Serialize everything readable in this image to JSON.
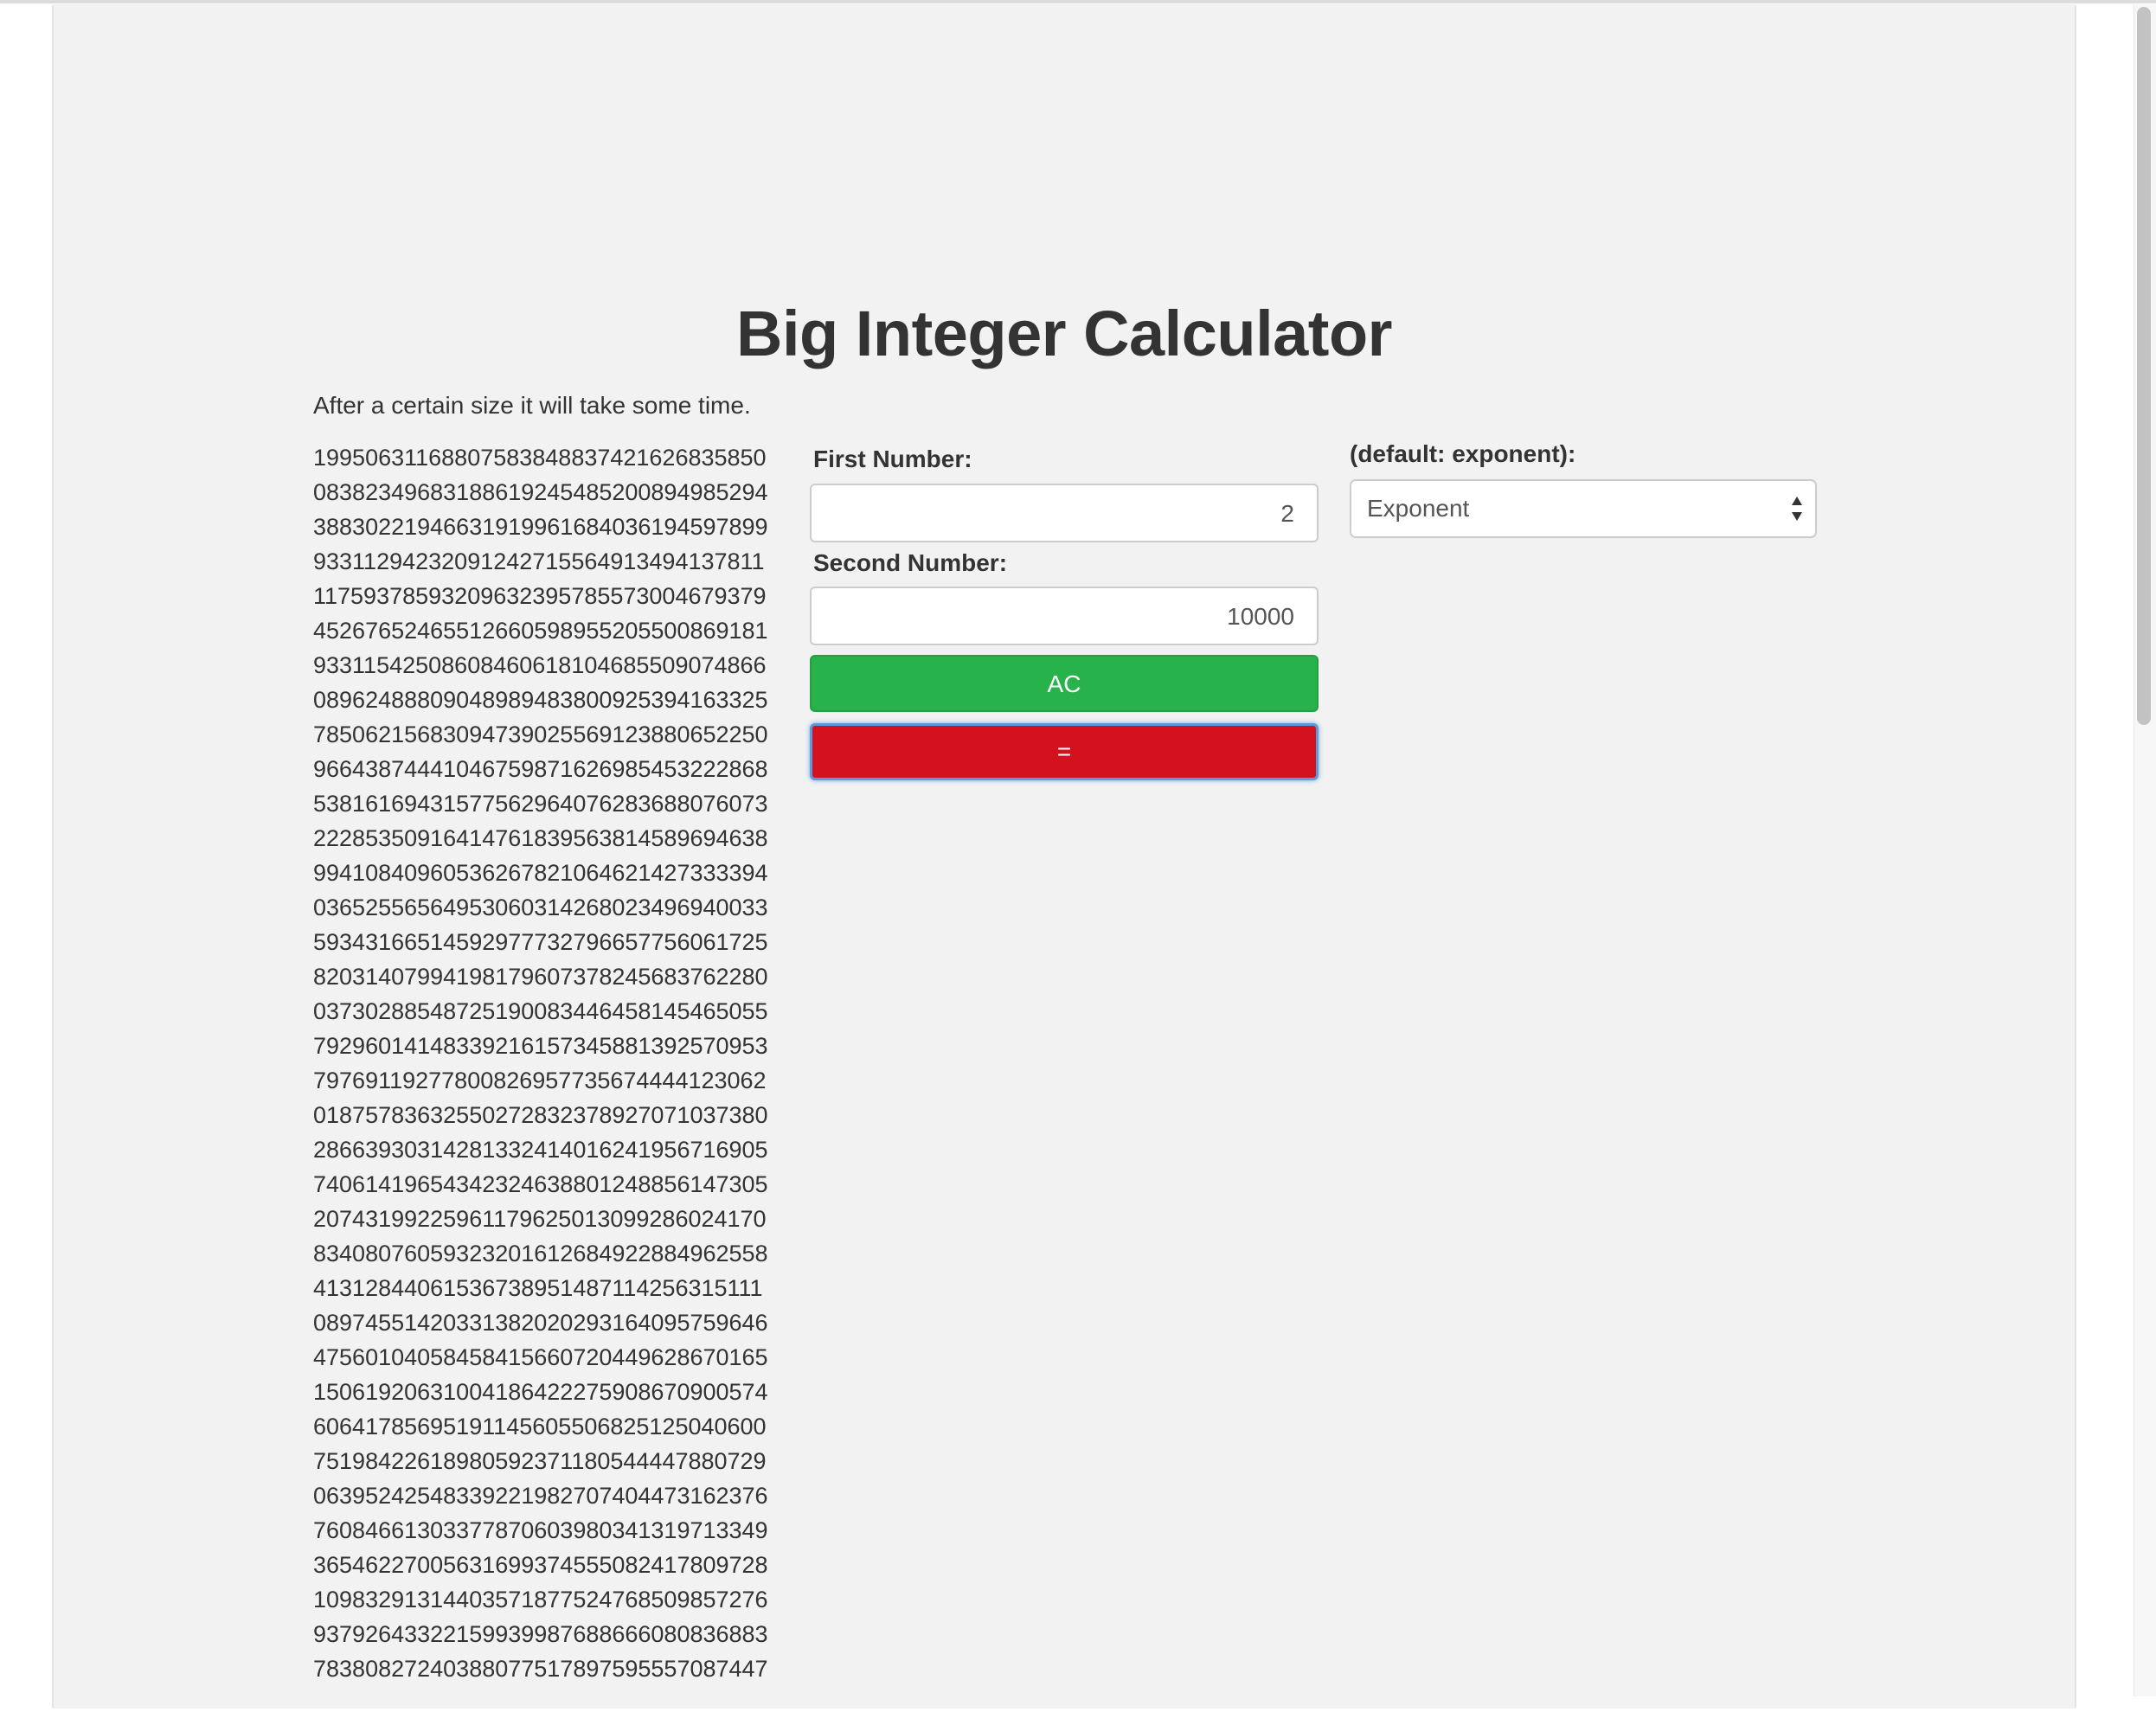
{
  "header": {
    "title": "Big Integer Calculator",
    "subtitle": "After a certain size it will take some time."
  },
  "form": {
    "first_label": "First Number:",
    "first_value": "2",
    "second_label": "Second Number:",
    "second_value": "10000",
    "ac_label": "AC",
    "equals_label": "=",
    "op_label": "(default: exponent):",
    "op_selected": "Exponent"
  },
  "result": {
    "lines": [
      "19950631168807583848837421626835850",
      "08382349683188619245485200894985294",
      "38830221946631919961684036194597899",
      "93311294232091242715564913494137811",
      "11759378593209632395785573004679379",
      "45267652465512660598955205500869181",
      "93311542508608460618104685509074866",
      "08962488809048989483800925394163325",
      "78506215683094739025569123880652250",
      "96643874441046759871626985453222868",
      "53816169431577562964076283688076073",
      "22285350916414761839563814589694638",
      "99410840960536267821064621427333394",
      "03652556564953060314268023496940033",
      "59343166514592977732796657756061725",
      "82031407994198179607378245683762280",
      "03730288548725190083446458145465055",
      "79296014148339216157345881392570953",
      "79769119277800826957735674444123062",
      "01875783632550272832378927071037380",
      "28663930314281332414016241956716905",
      "74061419654342324638801248856147305",
      "20743199225961179625013099286024170",
      "83408076059323201612684922884962558",
      "41312844061536738951487114256315111",
      "08974551420331382020293164095759646",
      "47560104058458415660720449628670165",
      "15061920631004186422275908670900574",
      "60641785695191145605506825125040600",
      "75198422618980592371180544447880729",
      "06395242548339221982707404473162376",
      "76084661303377870603980341319713349",
      "36546227005631699374555082417809728",
      "10983291314403571877524768509857276",
      "93792643322159939987688666080836883",
      "78380827240388077517897595557087447"
    ]
  }
}
